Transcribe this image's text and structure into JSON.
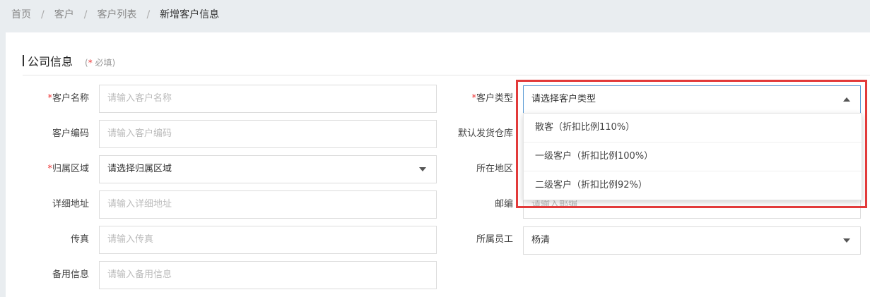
{
  "breadcrumb": {
    "items": [
      "首页",
      "客户",
      "客户列表"
    ],
    "separator": "/",
    "current": "新增客户信息"
  },
  "section": {
    "title": "公司信息",
    "hint_prefix": "(",
    "hint_star": "*",
    "hint_text": " 必填)"
  },
  "form": {
    "customer_name": {
      "label": "客户名称",
      "required": "*",
      "placeholder": "请输入客户名称"
    },
    "customer_code": {
      "label": "客户编码",
      "placeholder": "请输入客户编码"
    },
    "region": {
      "label": "归属区域",
      "required": "*",
      "value": "请选择归属区域"
    },
    "address": {
      "label": "详细地址",
      "placeholder": "请输入详细地址"
    },
    "fax": {
      "label": "传真",
      "placeholder": "请输入传真"
    },
    "backup": {
      "label": "备用信息",
      "placeholder": "请输入备用信息"
    },
    "customer_type": {
      "label": "客户类型",
      "required": "*",
      "value": "请选择客户类型"
    },
    "warehouse": {
      "label": "默认发货仓库"
    },
    "location": {
      "label": "所在地区"
    },
    "postcode": {
      "label": "邮编",
      "placeholder": "请输入邮编"
    },
    "staff": {
      "label": "所属员工",
      "value": "杨清"
    }
  },
  "customer_type_options": [
    "散客（折扣比例110%）",
    "一级客户（折扣比例100%）",
    "二级客户（折扣比例92%）"
  ],
  "colors": {
    "accent_highlight": "#e23a3a",
    "required": "#e33",
    "focus_border": "#5b9bd5"
  }
}
